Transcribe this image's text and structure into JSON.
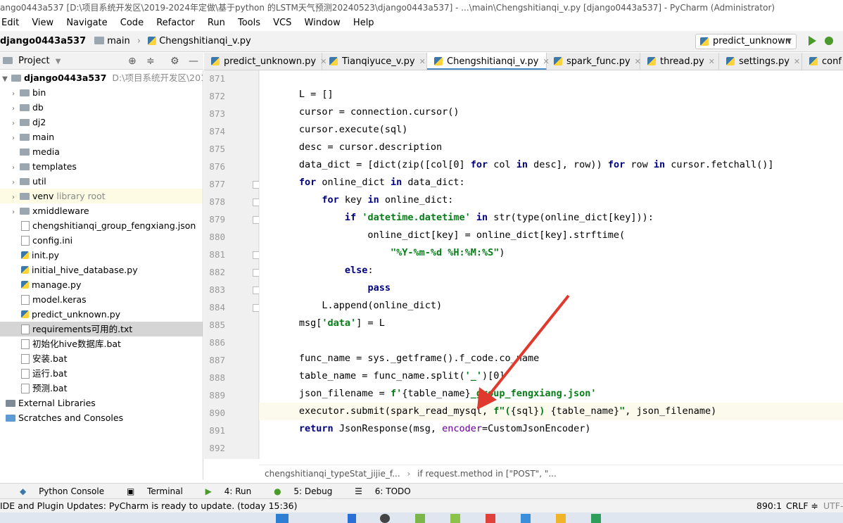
{
  "window": {
    "title": "ango0443a537 [D:\\项目系统开发区\\2019-2024年定做\\基于python 的LSTM天气预测20240523\\django0443a537] - ...\\main\\Chengshitianqi_v.py [django0443a537] - PyCharm (Administrator)"
  },
  "menu": [
    "Edit",
    "View",
    "Navigate",
    "Code",
    "Refactor",
    "Run",
    "Tools",
    "VCS",
    "Window",
    "Help"
  ],
  "nav": {
    "project": "django0443a537",
    "folder": "main",
    "file": "Chengshitianqi_v.py"
  },
  "run_config": "predict_unknown",
  "project_panel": {
    "title": "Project"
  },
  "tree": [
    {
      "label": "django0443a537",
      "extra": "D:\\项目系统开发区\\2019-2024",
      "type": "root"
    },
    {
      "label": "bin",
      "type": "folder"
    },
    {
      "label": "db",
      "type": "folder"
    },
    {
      "label": "dj2",
      "type": "folder"
    },
    {
      "label": "main",
      "type": "folder"
    },
    {
      "label": "media",
      "type": "folder-leaf"
    },
    {
      "label": "templates",
      "type": "folder"
    },
    {
      "label": "util",
      "type": "folder"
    },
    {
      "label": "venv",
      "extra": "library root",
      "type": "venv"
    },
    {
      "label": "xmiddleware",
      "type": "folder"
    },
    {
      "label": "chengshitianqi_group_fengxiang.json",
      "type": "file"
    },
    {
      "label": "config.ini",
      "type": "file"
    },
    {
      "label": "init.py",
      "type": "py"
    },
    {
      "label": "initial_hive_database.py",
      "type": "py"
    },
    {
      "label": "manage.py",
      "type": "py"
    },
    {
      "label": "model.keras",
      "type": "file"
    },
    {
      "label": "predict_unknown.py",
      "type": "py"
    },
    {
      "label": "requirements可用的.txt",
      "type": "file",
      "selected": true
    },
    {
      "label": "初始化hive数据库.bat",
      "type": "file"
    },
    {
      "label": "安装.bat",
      "type": "file"
    },
    {
      "label": "运行.bat",
      "type": "file"
    },
    {
      "label": "预测.bat",
      "type": "file"
    },
    {
      "label": "External Libraries",
      "type": "ext"
    },
    {
      "label": "Scratches and Consoles",
      "type": "ext"
    }
  ],
  "tabs": [
    {
      "label": "predict_unknown.py"
    },
    {
      "label": "Tianqiyuce_v.py"
    },
    {
      "label": "Chengshitianqi_v.py",
      "active": true
    },
    {
      "label": "spark_func.py"
    },
    {
      "label": "thread.py"
    },
    {
      "label": "settings.py"
    },
    {
      "label": "conf"
    }
  ],
  "line_numbers": [
    "871",
    "872",
    "873",
    "874",
    "875",
    "876",
    "877",
    "878",
    "879",
    "880",
    "881",
    "882",
    "883",
    "884",
    "885",
    "886",
    "887",
    "888",
    "889",
    "890",
    "891",
    "892"
  ],
  "breadcrumb": {
    "func": "chengshitianqi_typeStat_jijie_f...",
    "cond": "if request.method in [\"POST\", \"..."
  },
  "tool_windows": [
    "Python Console",
    "Terminal",
    "4: Run",
    "5: Debug",
    "6: TODO"
  ],
  "status": {
    "message": "IDE and Plugin Updates: PyCharm is ready to update. (today 15:36)",
    "position": "890:1",
    "line_sep": "CRLF ≑",
    "encoding": "UTF-"
  },
  "colors": {
    "keyword": "#000080",
    "string": "#067d17",
    "kwarg": "#660099",
    "arrow": "#e03a2f"
  }
}
